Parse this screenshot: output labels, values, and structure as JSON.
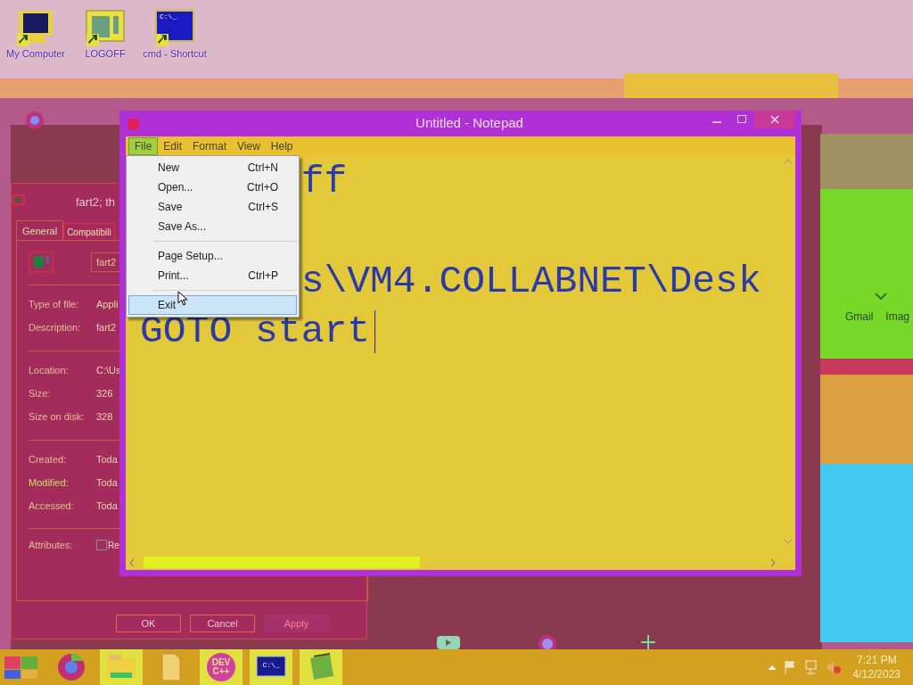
{
  "desktop_icons": [
    {
      "label": "My Computer",
      "kind": "computer"
    },
    {
      "label": "LOGOFF",
      "kind": "window"
    },
    {
      "label": "cmd - Shortcut",
      "kind": "console",
      "screen_text": "C:\\_"
    }
  ],
  "properties": {
    "title": "fart2; th",
    "tabs": [
      {
        "label": "General",
        "selected": true
      },
      {
        "label": "Compatibili",
        "selected": false
      }
    ],
    "name_value": "fart2",
    "groups": [
      [
        {
          "label": "Type of file:",
          "value": "Appli"
        },
        {
          "label": "Description:",
          "value": "fart2"
        }
      ],
      [
        {
          "label": "Location:",
          "value": "C:\\Us"
        },
        {
          "label": "Size:",
          "value": "326"
        },
        {
          "label": "Size on disk:",
          "value": "328"
        }
      ],
      [
        {
          "label": "Created:",
          "value": "Toda"
        },
        {
          "label": "Modified:",
          "value": "Toda"
        },
        {
          "label": "Accessed:",
          "value": "Toda"
        }
      ]
    ],
    "attribute": {
      "label": "Attributes:",
      "option": "Re",
      "checked": false
    },
    "buttons": [
      {
        "label": "OK",
        "disabled": false
      },
      {
        "label": "Cancel",
        "disabled": false
      },
      {
        "label": "Apply",
        "disabled": true
      }
    ]
  },
  "notepad": {
    "title": "Untitled - Notepad",
    "menu": [
      {
        "label": "File",
        "selected": true
      },
      {
        "label": "Edit",
        "selected": false
      },
      {
        "label": "Format",
        "selected": false
      },
      {
        "label": "View",
        "selected": false
      },
      {
        "label": "Help",
        "selected": false
      }
    ],
    "file_menu": [
      {
        "kind": "item",
        "label": "New",
        "shortcut": "Ctrl+N",
        "selected": false
      },
      {
        "kind": "item",
        "label": "Open...",
        "shortcut": "Ctrl+O",
        "selected": false
      },
      {
        "kind": "item",
        "label": "Save",
        "shortcut": "Ctrl+S",
        "selected": false
      },
      {
        "kind": "item",
        "label": "Save As...",
        "selected": false
      },
      {
        "kind": "separator"
      },
      {
        "kind": "item",
        "label": "Page Setup...",
        "selected": false
      },
      {
        "kind": "item",
        "label": "Print...",
        "shortcut": "Ctrl+P",
        "selected": false
      },
      {
        "kind": "separator"
      },
      {
        "kind": "item",
        "label": "Exit",
        "selected": true
      }
    ],
    "lines": [
      "ff",
      "s\\VM4.COLLABNET\\Desk",
      "GOTO start"
    ]
  },
  "browser": {
    "links": [
      "Gmail",
      "Imag"
    ]
  },
  "taskbar": {
    "apps": [
      {
        "kind": "start"
      },
      {
        "kind": "chrome"
      },
      {
        "kind": "explorer"
      },
      {
        "kind": "file"
      },
      {
        "kind": "devcpp",
        "text": [
          "DEV",
          "C++"
        ]
      },
      {
        "kind": "console",
        "text": [
          "C:\\_"
        ]
      },
      {
        "kind": "notepad"
      }
    ],
    "time": "7:21 PM",
    "date": "4/12/2023"
  }
}
